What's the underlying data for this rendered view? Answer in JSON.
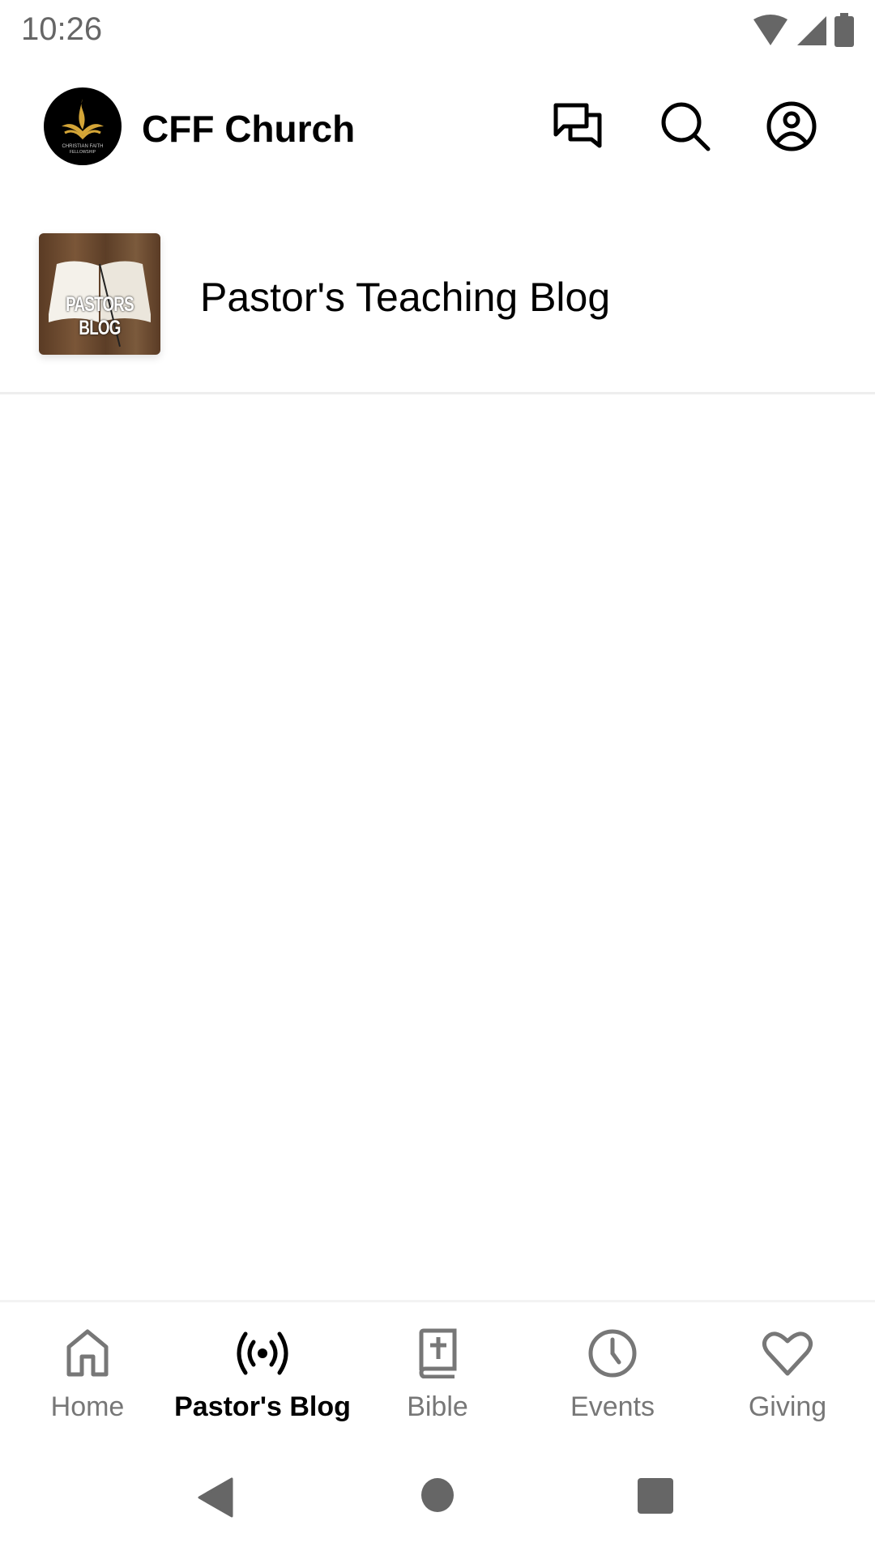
{
  "status_bar": {
    "time": "10:26",
    "icons": [
      "wifi-icon",
      "signal-icon",
      "battery-icon"
    ]
  },
  "app_bar": {
    "logo_text": "CHRISTIAN FAITH FELLOWSHIP",
    "title": "CFF Church",
    "actions": [
      "chat-icon",
      "search-icon",
      "account-icon"
    ]
  },
  "feed": {
    "items": [
      {
        "thumbnail_text": "PASTORS BLOG",
        "title": "Pastor's Teaching Blog"
      }
    ]
  },
  "bottom_nav": {
    "items": [
      {
        "label": "Home",
        "icon": "home-icon",
        "active": false
      },
      {
        "label": "Pastor's Blog",
        "icon": "broadcast-icon",
        "active": true
      },
      {
        "label": "Bible",
        "icon": "bible-icon",
        "active": false
      },
      {
        "label": "Events",
        "icon": "clock-icon",
        "active": false
      },
      {
        "label": "Giving",
        "icon": "heart-icon",
        "active": false
      }
    ]
  },
  "colors": {
    "active": "#000000",
    "inactive": "#777777",
    "logo_gold": "#d4a537"
  }
}
